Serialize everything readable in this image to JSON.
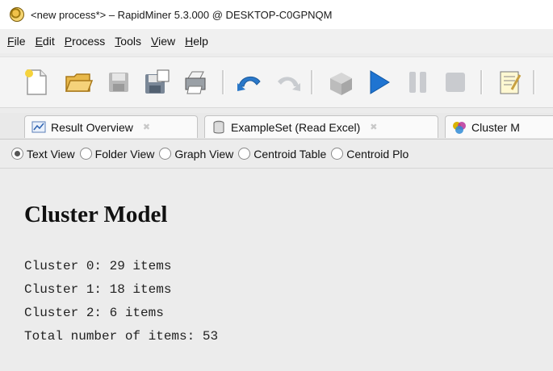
{
  "window": {
    "title": "<new process*> – RapidMiner 5.3.000 @ DESKTOP-C0GPNQM"
  },
  "menu": [
    {
      "label": "File",
      "mnemonic": "F",
      "rest": "ile"
    },
    {
      "label": "Edit",
      "mnemonic": "E",
      "rest": "dit"
    },
    {
      "label": "Process",
      "mnemonic": "P",
      "rest": "rocess"
    },
    {
      "label": "Tools",
      "mnemonic": "T",
      "rest": "ools"
    },
    {
      "label": "View",
      "mnemonic": "V",
      "rest": "iew"
    },
    {
      "label": "Help",
      "mnemonic": "H",
      "rest": "elp"
    }
  ],
  "toolbar": {
    "icons": [
      "new-process-icon",
      "open-folder-icon",
      "save-icon",
      "save-as-icon",
      "print-icon",
      "undo-icon",
      "redo-icon",
      "cube-icon",
      "run-icon",
      "pause-icon",
      "stop-icon",
      "notes-icon"
    ]
  },
  "tabs": [
    {
      "label": "Result Overview",
      "icon": "result-overview-icon"
    },
    {
      "label": "ExampleSet (Read Excel)",
      "icon": "exampleset-icon"
    },
    {
      "label": "Cluster M",
      "icon": "cluster-model-icon"
    }
  ],
  "views": [
    {
      "label": "Text View",
      "selected": true
    },
    {
      "label": "Folder View",
      "selected": false
    },
    {
      "label": "Graph View",
      "selected": false
    },
    {
      "label": "Centroid Table",
      "selected": false
    },
    {
      "label": "Centroid Plo",
      "selected": false
    }
  ],
  "content": {
    "title": "Cluster Model",
    "lines": [
      "Cluster 0: 29 items",
      "Cluster 1: 18 items",
      "Cluster 2: 6 items",
      "Total number of items: 53"
    ]
  }
}
